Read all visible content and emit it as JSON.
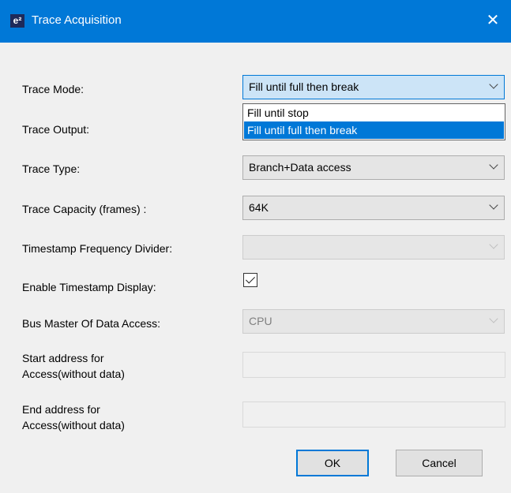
{
  "window": {
    "title": "Trace Acquisition",
    "logo_text": "e²",
    "close_glyph": "✕"
  },
  "fields": {
    "trace_mode": {
      "label": "Trace Mode:",
      "value": "Fill until full then break"
    },
    "trace_mode_dropdown": {
      "options": [
        "Fill until stop",
        "Fill until full then break"
      ],
      "selected_index": 1
    },
    "trace_output": {
      "label": "Trace Output:"
    },
    "trace_type": {
      "label": "Trace Type:",
      "value": "Branch+Data access"
    },
    "trace_capacity": {
      "label": "Trace Capacity (frames) :",
      "value": "64K"
    },
    "timestamp_divider": {
      "label": "Timestamp Frequency Divider:",
      "value": ""
    },
    "enable_timestamp": {
      "label": "Enable Timestamp Display:",
      "checked": true
    },
    "bus_master": {
      "label": "Bus Master Of Data Access:",
      "value": "CPU"
    },
    "start_address": {
      "label_line1": "Start address for",
      "label_line2": "Access(without data)",
      "value": ""
    },
    "end_address": {
      "label_line1": "End address for",
      "label_line2": "Access(without data)",
      "value": ""
    }
  },
  "buttons": {
    "ok": "OK",
    "cancel": "Cancel"
  },
  "colors": {
    "titlebar": "#0078d7",
    "selection": "#0078d7",
    "background": "#f0f0f0"
  }
}
